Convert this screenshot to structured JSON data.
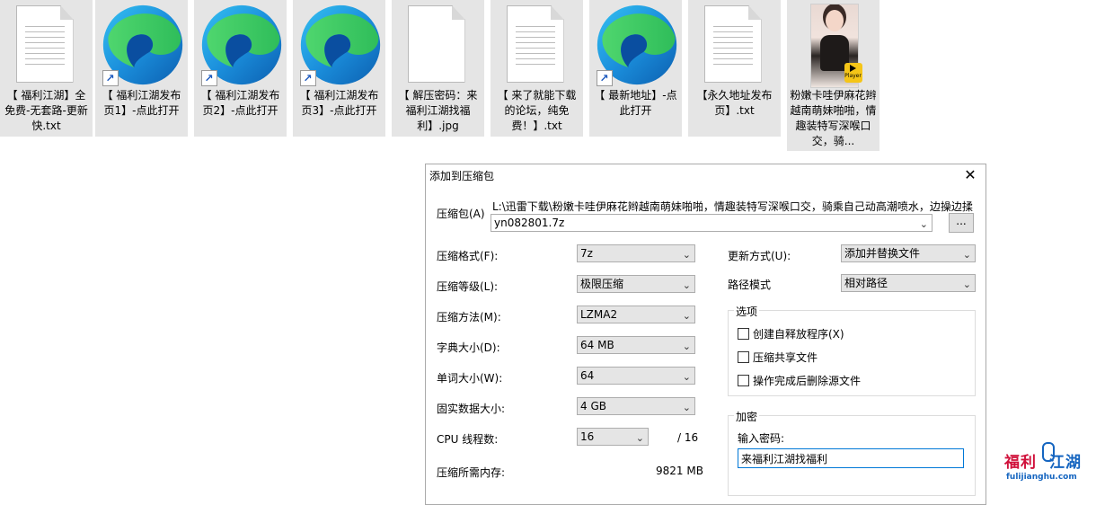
{
  "desktop": {
    "files": [
      {
        "type": "txt",
        "label": "【 福利江湖】全免费-无套路-更新快.txt"
      },
      {
        "type": "edge",
        "label": "【 福利江湖发布页1】-点此打开"
      },
      {
        "type": "edge",
        "label": "【 福利江湖发布页2】-点此打开"
      },
      {
        "type": "edge",
        "label": "【 福利江湖发布页3】-点此打开"
      },
      {
        "type": "blank",
        "label": "【 解压密码：来福利江湖找福利】.jpg"
      },
      {
        "type": "txt",
        "label": "【 来了就能下载的论坛，纯免费！】.txt"
      },
      {
        "type": "edge",
        "label": "【 最新地址】-点此打开"
      },
      {
        "type": "txt",
        "label": "【永久地址发布页】.txt"
      },
      {
        "type": "video",
        "label": "粉嫩卡哇伊麻花辫越南萌妹啪啪，情趣装特写深喉口交，骑...",
        "badge": "Player"
      }
    ]
  },
  "dialog": {
    "title": "添加到压缩包",
    "archive_label": "压缩包(A)",
    "archive_path": "L:\\迅雷下载\\粉嫩卡哇伊麻花辫越南萌妹啪啪，情趣装特写深喉口交，骑乘自己动高潮喷水，边操边揉",
    "archive_name": "yn082801.7z",
    "browse_label": "...",
    "left_fields": [
      {
        "label": "压缩格式(F):",
        "value": "7z"
      },
      {
        "label": "压缩等级(L):",
        "value": "极限压缩"
      },
      {
        "label": "压缩方法(M):",
        "value": "LZMA2"
      },
      {
        "label": "字典大小(D):",
        "value": "64 MB"
      },
      {
        "label": "单词大小(W):",
        "value": "64"
      },
      {
        "label": "固实数据大小:",
        "value": "4 GB"
      }
    ],
    "cpu_label": "CPU 线程数:",
    "cpu_value": "16",
    "cpu_total": "/ 16",
    "memory_label": "压缩所需内存:",
    "memory_value": "9821 MB",
    "update_label": "更新方式(U):",
    "update_value": "添加并替换文件",
    "path_mode_label": "路径模式",
    "path_mode_value": "相对路径",
    "options_title": "选项",
    "options": [
      {
        "label": "创建自释放程序(X)",
        "checked": false
      },
      {
        "label": "压缩共享文件",
        "checked": false
      },
      {
        "label": "操作完成后删除源文件",
        "checked": false
      }
    ],
    "encrypt_title": "加密",
    "password_label": "输入密码:",
    "password_value": "来福利江湖找福利"
  },
  "watermark": {
    "main_red": "福利",
    "main_blue": "江湖",
    "sub": "fulijianghu.com"
  },
  "colors": {
    "file_bg": "#e5e5e5",
    "focus_border": "#0078d7",
    "watermark_red": "#d0103a",
    "watermark_blue": "#1565c0"
  }
}
